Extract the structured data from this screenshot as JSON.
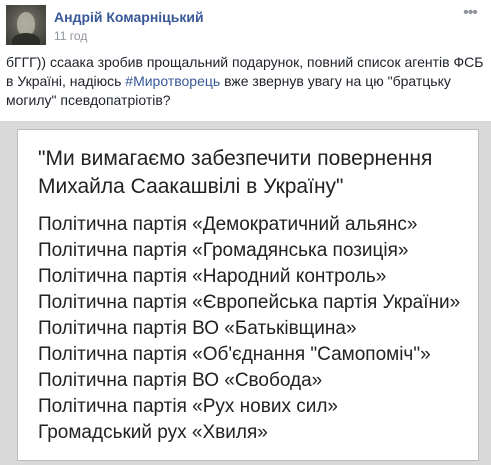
{
  "post": {
    "author": "Андрій Комарніцький",
    "timestamp": "11 год",
    "more_icon": "ellipsis-icon",
    "text_before_hashtag": "бГГГ)) ссаака зробив прощальний подарунок, повний список агентів ФСБ в Україні, надіюсь ",
    "hashtag": "#Миротворець",
    "text_after_hashtag": " вже звернув увагу на цю \"братцьку могилу\" псевдопатріотів?"
  },
  "image": {
    "quote_line_1": "\"Ми вимагаємо забезпечити повернення",
    "quote_line_2": "Михайла Саакашвілі в Україну\"",
    "parties": [
      "Політична партія «Демократичний альянс»",
      "Політична партія «Громадянська позиція»",
      "Політична партія «Народний контроль»",
      "Політична партія «Європейська партія України»",
      "Політична партія ВО «Батьківщина»",
      "Політична партія «Об'єднання \"Самопоміч\"»",
      "Політична партія ВО «Свобода»",
      "Політична партія «Рух нових сил»",
      "Громадський рух «Хвиля»"
    ]
  },
  "colors": {
    "link": "#385898",
    "muted": "#90949c",
    "text": "#1d2129"
  }
}
